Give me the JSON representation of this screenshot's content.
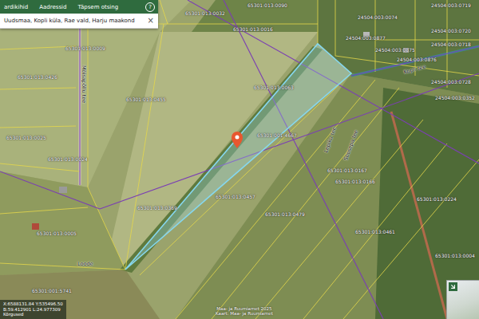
{
  "panel": {
    "tabs": [
      {
        "label": "ardikihid",
        "selected": false
      },
      {
        "label": "Aadressid",
        "selected": false
      },
      {
        "label": "Täpsem otsing",
        "selected": false
      }
    ],
    "help": "?",
    "search": {
      "value": "Uudsmaa, Kopli küla, Rae vald, Harju maakond",
      "clear": "×"
    }
  },
  "map": {
    "parcel_labels": [
      "65301:013:0032",
      "65301:013:0090",
      "65301:013:0016",
      "65301:013:0009",
      "65301:013:0426",
      "65301:013:0455",
      "65301:013:0063",
      "65301:001:4667",
      "65301:013:0025",
      "65301:013:0024",
      "65301:013:0369",
      "65301:013:0457",
      "65301:013:0479",
      "65301:013:0167",
      "65301:013:0166",
      "65301:013:0224",
      "65301:013:0461",
      "65301:013:0004",
      "65301:013:0005",
      "65301:001:5741",
      "24504:003:0074",
      "24504:003:0719",
      "24504:003:0720",
      "24504:003:0718",
      "24504:003:0877",
      "24504:003:0875",
      "24504:003:0876",
      "24504:003:0728",
      "24504:003:0352"
    ],
    "road_labels": [
      "Mõisapõllu tee",
      "Loode",
      "Lepiku tee",
      "Soosepa tee",
      "Kopli tee"
    ]
  },
  "coordinates": {
    "xy": "X:6588131.84 Y:535496.50",
    "bl": "B:59.412901 L:24.977309",
    "heights": "Kõrgused"
  },
  "attribution": [
    "Maa- ja Ruumiamet 2025",
    "Kaart: Maa- ja Ruumiamet"
  ]
}
